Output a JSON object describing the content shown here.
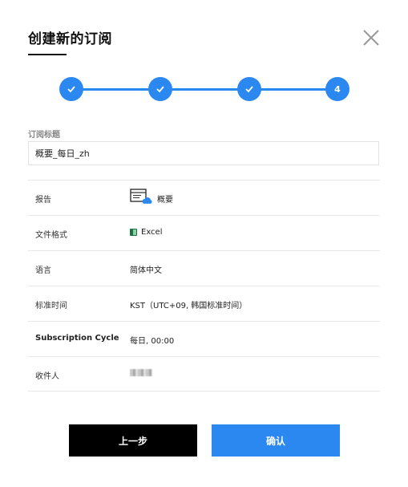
{
  "dialog": {
    "title": "创建新的订阅"
  },
  "stepper": {
    "steps": [
      {
        "state": "completed",
        "icon": "check-icon"
      },
      {
        "state": "completed",
        "icon": "check-icon"
      },
      {
        "state": "completed",
        "icon": "check-icon"
      },
      {
        "state": "current",
        "label": "4"
      }
    ],
    "accent_color": "#2a88f0"
  },
  "subscription_title": {
    "label": "订阅标题",
    "value": "概要_每日_zh"
  },
  "details": {
    "report_label": "报告",
    "report_value": "概要",
    "format_label": "文件格式",
    "format_value": "Excel",
    "language_label": "语言",
    "language_value": "简体中文",
    "timezone_label": "标准时间",
    "timezone_value": "KST（UTC+09, 韩国标准时间）",
    "cycle_label": "Subscription Cycle",
    "cycle_value": "每日, 00:00",
    "recipient_label": "收件人"
  },
  "buttons": {
    "prev_label": "上一步",
    "confirm_label": "确认"
  },
  "colors": {
    "primary": "#2a88f0",
    "dark": "#000000"
  }
}
